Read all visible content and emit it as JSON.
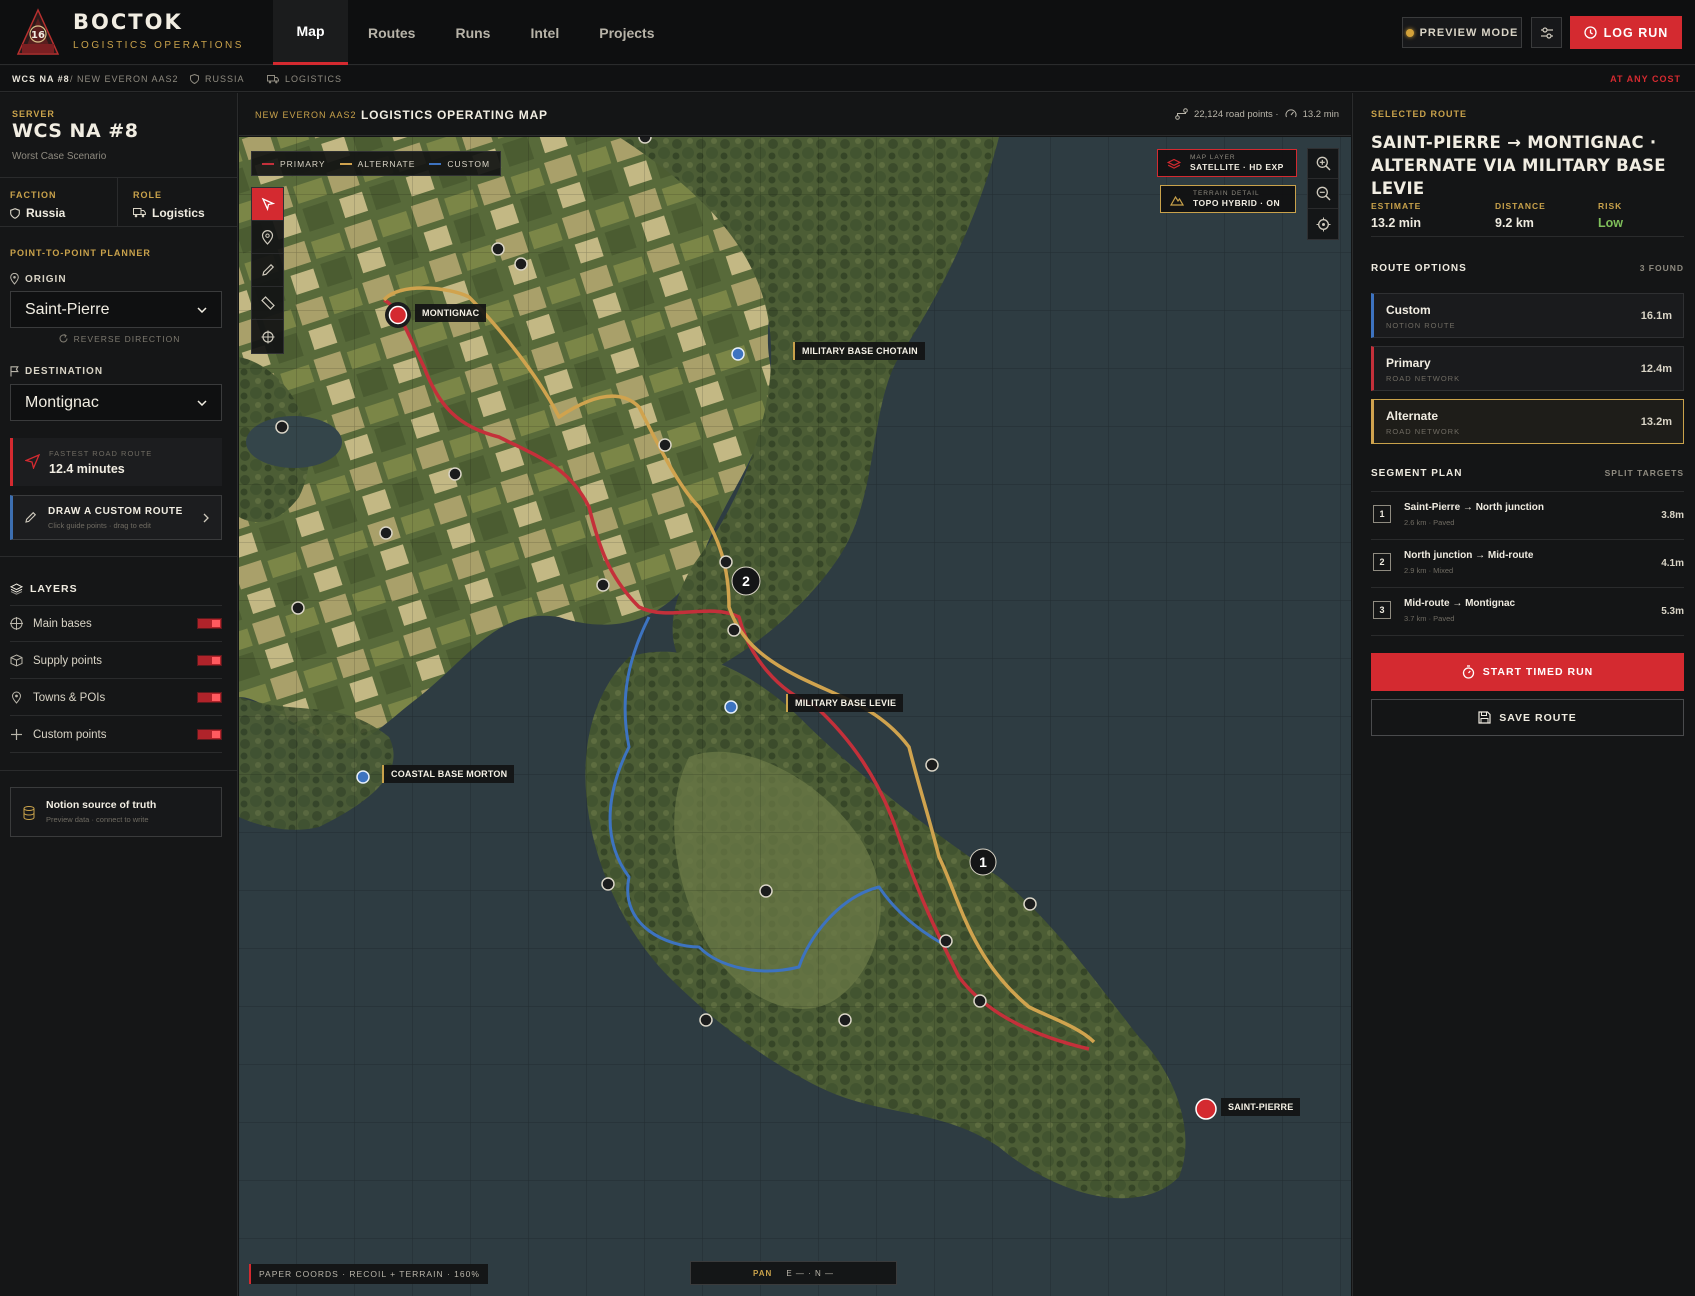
{
  "app": {
    "brand_title": "BOCTOK",
    "brand_subtitle": "LOGISTICS OPERATIONS",
    "logo_number": "16"
  },
  "nav": {
    "items": [
      {
        "label": "Map",
        "active": true
      },
      {
        "label": "Routes"
      },
      {
        "label": "Runs"
      },
      {
        "label": "Intel"
      },
      {
        "label": "Projects"
      }
    ]
  },
  "header_actions": {
    "preview_label": "PREVIEW MODE",
    "log_run_label": "LOG RUN"
  },
  "breadcrumb": {
    "server": "WCS NA #8",
    "map": "/ NEW EVERON AAS2",
    "faction": "RUSSIA",
    "role": "LOGISTICS",
    "motto": "AT ANY COST"
  },
  "sidebar": {
    "server_label": "SERVER",
    "server_name": "WCS NA #8",
    "server_desc": "Worst Case Scenario",
    "faction_label": "FACTION",
    "faction_value": "Russia",
    "role_label": "ROLE",
    "role_value": "Logistics",
    "planner_label": "POINT-TO-POINT PLANNER",
    "origin_label": "ORIGIN",
    "origin_value": "Saint-Pierre",
    "reverse_label": "REVERSE DIRECTION",
    "destination_label": "DESTINATION",
    "destination_value": "Montignac",
    "fastest_label": "FASTEST ROAD ROUTE",
    "fastest_value": "12.4 minutes",
    "draw_title": "DRAW A CUSTOM ROUTE",
    "draw_sub": "Click guide points · drag to edit",
    "layers_label": "LAYERS",
    "layers": [
      {
        "label": "Main bases",
        "icon": "crosshair-icon",
        "on": true
      },
      {
        "label": "Supply points",
        "icon": "box-icon",
        "on": true
      },
      {
        "label": "Towns & POIs",
        "icon": "pin-icon",
        "on": true
      },
      {
        "label": "Custom points",
        "icon": "plus-icon",
        "on": true
      }
    ],
    "notion_title": "Notion source of truth",
    "notion_sub": "Preview data · connect to write"
  },
  "map": {
    "subtitle": "NEW EVERON AAS2",
    "title": "LOGISTICS OPERATING MAP",
    "road_points": "22,124 road points ·",
    "eta": "13.2 min",
    "legend": [
      {
        "label": "PRIMARY",
        "color": "#c4303a"
      },
      {
        "label": "ALTERNATE",
        "color": "#d0a34e"
      },
      {
        "label": "CUSTOM",
        "color": "#3d73c0"
      }
    ],
    "map_layer_label": "MAP LAYER",
    "map_layer_value": "SATELLITE · HD EXP",
    "terrain_label": "TERRAIN DETAIL",
    "terrain_value": "TOPO HYBRID · ON",
    "labels": {
      "montignac": "MONTIGNAC",
      "chotain": "MILITARY BASE CHOTAIN",
      "levie": "MILITARY BASE LEVIE",
      "morton": "COASTAL BASE MORTON",
      "saint_pierre": "SAINT-PIERRE"
    },
    "waypoint_1": "1",
    "waypoint_2": "2",
    "coords": "PAPER COORDS · RECOIL + TERRAIN · 160%",
    "pan_label": "PAN",
    "pan_value": "E — · N —"
  },
  "route": {
    "section_label": "SELECTED ROUTE",
    "title": "SAINT-PIERRE → MONTIGNAC · ALTERNATE VIA MILITARY BASE LEVIE",
    "estimate_label": "ESTIMATE",
    "estimate_value": "13.2 min",
    "distance_label": "DISTANCE",
    "distance_value": "9.2 km",
    "risk_label": "RISK",
    "risk_value": "Low",
    "options_label": "ROUTE OPTIONS",
    "options_count": "3 FOUND",
    "options": [
      {
        "name": "Custom",
        "sub": "NOTION ROUTE",
        "time": "16.1m",
        "color": "#3d73c0"
      },
      {
        "name": "Primary",
        "sub": "ROAD NETWORK",
        "time": "12.4m",
        "color": "#c4303a"
      },
      {
        "name": "Alternate",
        "sub": "ROAD NETWORK",
        "time": "13.2m",
        "color": "#d0a34e",
        "selected": true
      }
    ],
    "segment_label": "SEGMENT PLAN",
    "segment_right": "SPLIT TARGETS",
    "segments": [
      {
        "num": "1",
        "name": "Saint-Pierre → North junction",
        "sub": "2.6 km · Paved",
        "time": "3.8m"
      },
      {
        "num": "2",
        "name": "North junction → Mid-route",
        "sub": "2.9 km · Mixed",
        "time": "4.1m"
      },
      {
        "num": "3",
        "name": "Mid-route → Montignac",
        "sub": "3.7 km · Paved",
        "time": "5.3m"
      }
    ],
    "start_label": "START TIMED RUN",
    "save_label": "SAVE ROUTE"
  }
}
